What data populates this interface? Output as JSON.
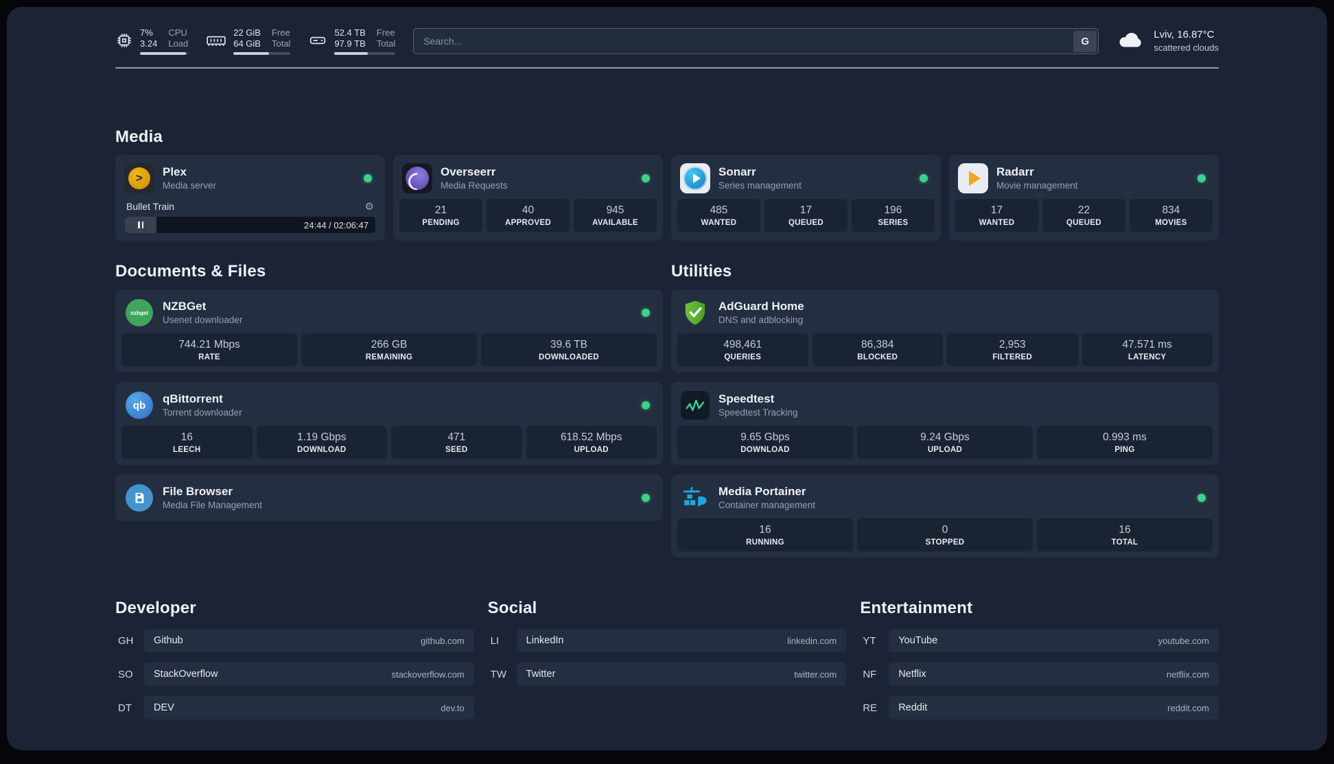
{
  "colors": {
    "background": "#1b2334",
    "card": "#242e41",
    "stat_box": "#1a2332",
    "status_ok": "#3ed188",
    "plex_amber": "#e5a00d",
    "radarr_amber": "#f6a51f",
    "sonarr_blue": "#1787c9",
    "overseerr_purple": "#5b48ad",
    "nzbget_green": "#3fa55a",
    "qbittorrent_blue": "#2e6fc2",
    "adguard_green": "#5fb32e",
    "speedtest_green": "#34d399",
    "portainer_blue": "#1ba8e0"
  },
  "topbar": {
    "metrics": [
      {
        "icon": "cpu-icon",
        "v1": "7%",
        "l1": "CPU",
        "v2": "3.24",
        "l2": "Load",
        "fill": 95
      },
      {
        "icon": "memory-icon",
        "v1": "22 GiB",
        "l1": "Free",
        "v2": "64 GiB",
        "l2": "Total",
        "fill": 62
      },
      {
        "icon": "disk-icon",
        "v1": "52.4 TB",
        "l1": "Free",
        "v2": "97.9 TB",
        "l2": "Total",
        "fill": 55
      }
    ],
    "search": {
      "placeholder": "Search...",
      "button_label": "G"
    },
    "weather": {
      "icon": "cloud-icon",
      "location": "Lviv, 16.87°C",
      "condition": "scattered clouds"
    }
  },
  "media": {
    "title": "Media",
    "plex": {
      "name": "Plex",
      "subtitle": "Media server",
      "icon": "plex-icon",
      "status": "online",
      "track": "Bullet Train",
      "time": "24:44 / 02:06:47"
    },
    "cards": [
      {
        "name": "Overseerr",
        "subtitle": "Media Requests",
        "icon": "overseerr-icon",
        "status": "online",
        "stats": [
          {
            "value": "21",
            "label": "PENDING"
          },
          {
            "value": "40",
            "label": "APPROVED"
          },
          {
            "value": "945",
            "label": "AVAILABLE"
          }
        ]
      },
      {
        "name": "Sonarr",
        "subtitle": "Series management",
        "icon": "sonarr-icon",
        "status": "online",
        "stats": [
          {
            "value": "485",
            "label": "WANTED"
          },
          {
            "value": "17",
            "label": "QUEUED"
          },
          {
            "value": "196",
            "label": "SERIES"
          }
        ]
      },
      {
        "name": "Radarr",
        "subtitle": "Movie management",
        "icon": "radarr-icon",
        "status": "online",
        "stats": [
          {
            "value": "17",
            "label": "WANTED"
          },
          {
            "value": "22",
            "label": "QUEUED"
          },
          {
            "value": "834",
            "label": "MOVIES"
          }
        ]
      }
    ]
  },
  "documents": {
    "title": "Documents & Files",
    "cards": [
      {
        "name": "NZBGet",
        "subtitle": "Usenet downloader",
        "icon": "nzbget-icon",
        "status": "online",
        "stats": [
          {
            "value": "744.21 Mbps",
            "label": "RATE"
          },
          {
            "value": "266 GB",
            "label": "REMAINING"
          },
          {
            "value": "39.6 TB",
            "label": "DOWNLOADED"
          }
        ]
      },
      {
        "name": "qBittorrent",
        "subtitle": "Torrent downloader",
        "icon": "qbittorrent-icon",
        "status": "online",
        "stats": [
          {
            "value": "16",
            "label": "LEECH"
          },
          {
            "value": "1.19 Gbps",
            "label": "DOWNLOAD"
          },
          {
            "value": "471",
            "label": "SEED"
          },
          {
            "value": "618.52 Mbps",
            "label": "UPLOAD"
          }
        ]
      },
      {
        "name": "File Browser",
        "subtitle": "Media File Management",
        "icon": "filebrowser-icon",
        "status": "online"
      }
    ]
  },
  "utilities": {
    "title": "Utilities",
    "cards": [
      {
        "name": "AdGuard Home",
        "subtitle": "DNS and adblocking",
        "icon": "adguard-icon",
        "stats": [
          {
            "value": "498,461",
            "label": "QUERIES"
          },
          {
            "value": "86,384",
            "label": "BLOCKED"
          },
          {
            "value": "2,953",
            "label": "FILTERED"
          },
          {
            "value": "47.571 ms",
            "label": "LATENCY"
          }
        ]
      },
      {
        "name": "Speedtest",
        "subtitle": "Speedtest Tracking",
        "icon": "speedtest-icon",
        "stats": [
          {
            "value": "9.65 Gbps",
            "label": "DOWNLOAD"
          },
          {
            "value": "9.24 Gbps",
            "label": "UPLOAD"
          },
          {
            "value": "0.993 ms",
            "label": "PING"
          }
        ]
      },
      {
        "name": "Media Portainer",
        "subtitle": "Container management",
        "icon": "portainer-icon",
        "status": "online",
        "stats": [
          {
            "value": "16",
            "label": "RUNNING"
          },
          {
            "value": "0",
            "label": "STOPPED"
          },
          {
            "value": "16",
            "label": "TOTAL"
          }
        ]
      }
    ]
  },
  "bookmarks": [
    {
      "title": "Developer",
      "items": [
        {
          "abbr": "GH",
          "name": "Github",
          "domain": "github.com"
        },
        {
          "abbr": "SO",
          "name": "StackOverflow",
          "domain": "stackoverflow.com"
        },
        {
          "abbr": "DT",
          "name": "DEV",
          "domain": "dev.to"
        }
      ]
    },
    {
      "title": "Social",
      "items": [
        {
          "abbr": "LI",
          "name": "LinkedIn",
          "domain": "linkedin.com"
        },
        {
          "abbr": "TW",
          "name": "Twitter",
          "domain": "twitter.com"
        }
      ]
    },
    {
      "title": "Entertainment",
      "items": [
        {
          "abbr": "YT",
          "name": "YouTube",
          "domain": "youtube.com"
        },
        {
          "abbr": "NF",
          "name": "Netflix",
          "domain": "netflix.com"
        },
        {
          "abbr": "RE",
          "name": "Reddit",
          "domain": "reddit.com"
        }
      ]
    }
  ]
}
